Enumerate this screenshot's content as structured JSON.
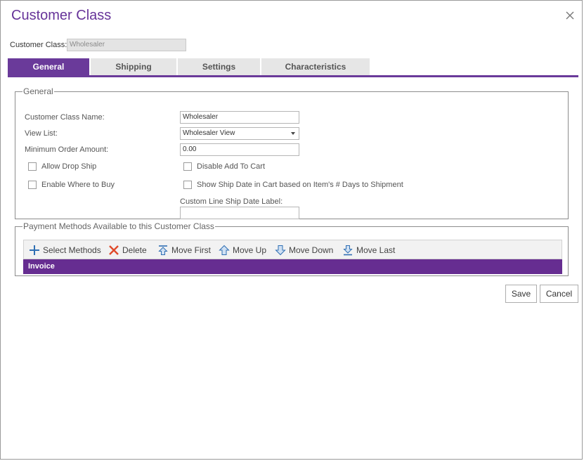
{
  "dialog": {
    "title": "Customer Class",
    "customer_class_label": "Customer Class:",
    "customer_class_value": "Wholesaler"
  },
  "tabs": [
    {
      "label": "General",
      "active": true
    },
    {
      "label": "Shipping",
      "active": false
    },
    {
      "label": "Settings",
      "active": false
    },
    {
      "label": "Characteristics",
      "active": false
    }
  ],
  "general": {
    "legend": "General",
    "name_label": "Customer Class Name:",
    "name_value": "Wholesaler",
    "view_list_label": "View List:",
    "view_list_value": "Wholesaler View",
    "min_order_label": "Minimum Order Amount:",
    "min_order_value": "0.00",
    "allow_drop_ship_label": "Allow Drop Ship",
    "allow_drop_ship_checked": false,
    "enable_where_to_buy_label": "Enable Where to Buy",
    "enable_where_to_buy_checked": false,
    "disable_add_to_cart_label": "Disable Add To Cart",
    "disable_add_to_cart_checked": false,
    "show_ship_date_label": "Show Ship Date in Cart based on Item's # Days to Shipment",
    "show_ship_date_checked": false,
    "custom_line_label": "Custom Line Ship Date Label:",
    "custom_line_value": ""
  },
  "payment": {
    "legend": "Payment Methods Available to this Customer Class",
    "toolbar": {
      "select_methods": "Select Methods",
      "delete": "Delete",
      "move_first": "Move First",
      "move_up": "Move Up",
      "move_down": "Move Down",
      "move_last": "Move Last"
    },
    "rows": [
      "Invoice"
    ]
  },
  "footer": {
    "save": "Save",
    "cancel": "Cancel"
  },
  "colors": {
    "accent": "#6a3a9a",
    "title": "#663399",
    "selected_row": "#662d91",
    "delete_icon": "#e04a2a",
    "toolbar_icon": "#2f6fb3"
  },
  "icons": {
    "close": "close-icon",
    "select_methods": "plus-icon",
    "delete": "delete-x-icon",
    "move_first": "move-first-icon",
    "move_up": "arrow-up-icon",
    "move_down": "arrow-down-icon",
    "move_last": "move-last-icon"
  }
}
